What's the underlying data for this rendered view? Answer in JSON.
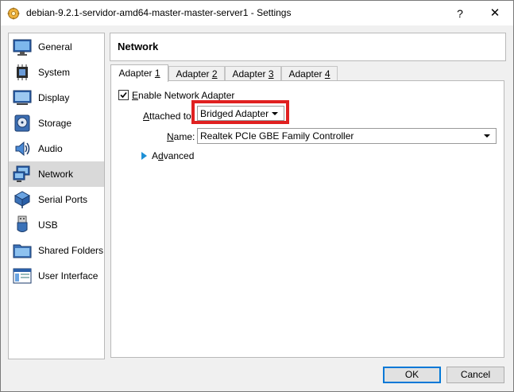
{
  "window": {
    "title": "debian-9.2.1-servidor-amd64-master-master-server1 - Settings",
    "help_label": "?",
    "close_label": "✕"
  },
  "sidebar": {
    "items": [
      {
        "label": "General",
        "icon": "general-icon",
        "selected": false
      },
      {
        "label": "System",
        "icon": "system-icon",
        "selected": false
      },
      {
        "label": "Display",
        "icon": "display-icon",
        "selected": false
      },
      {
        "label": "Storage",
        "icon": "storage-icon",
        "selected": false
      },
      {
        "label": "Audio",
        "icon": "audio-icon",
        "selected": false
      },
      {
        "label": "Network",
        "icon": "network-icon",
        "selected": true
      },
      {
        "label": "Serial Ports",
        "icon": "serial-ports-icon",
        "selected": false
      },
      {
        "label": "USB",
        "icon": "usb-icon",
        "selected": false
      },
      {
        "label": "Shared Folders",
        "icon": "shared-folders-icon",
        "selected": false
      },
      {
        "label": "User Interface",
        "icon": "user-interface-icon",
        "selected": false
      }
    ]
  },
  "main": {
    "title": "Network",
    "tabs": [
      {
        "prefix": "Adapter ",
        "mnemonic": "1",
        "active": true
      },
      {
        "prefix": "Adapter ",
        "mnemonic": "2",
        "active": false
      },
      {
        "prefix": "Adapter ",
        "mnemonic": "3",
        "active": false
      },
      {
        "prefix": "Adapter ",
        "mnemonic": "4",
        "active": false
      }
    ],
    "enable_adapter": {
      "mnemonic": "E",
      "rest": "nable Network Adapter",
      "checked": true
    },
    "attached_to": {
      "mnemonic": "A",
      "rest": "ttached to:",
      "value": "Bridged Adapter"
    },
    "name": {
      "mnemonic": "N",
      "rest": "ame:",
      "value": "Realtek PCIe GBE Family Controller"
    },
    "advanced": {
      "mnemonic": "d",
      "pre": "A",
      "rest": "vanced"
    }
  },
  "buttons": {
    "ok": "OK",
    "cancel": "Cancel"
  },
  "colors": {
    "highlight": "#e02020",
    "selected_item": "#d9d9d9",
    "accent": "#0078d7",
    "advanced_arrow": "#1e90d6"
  }
}
